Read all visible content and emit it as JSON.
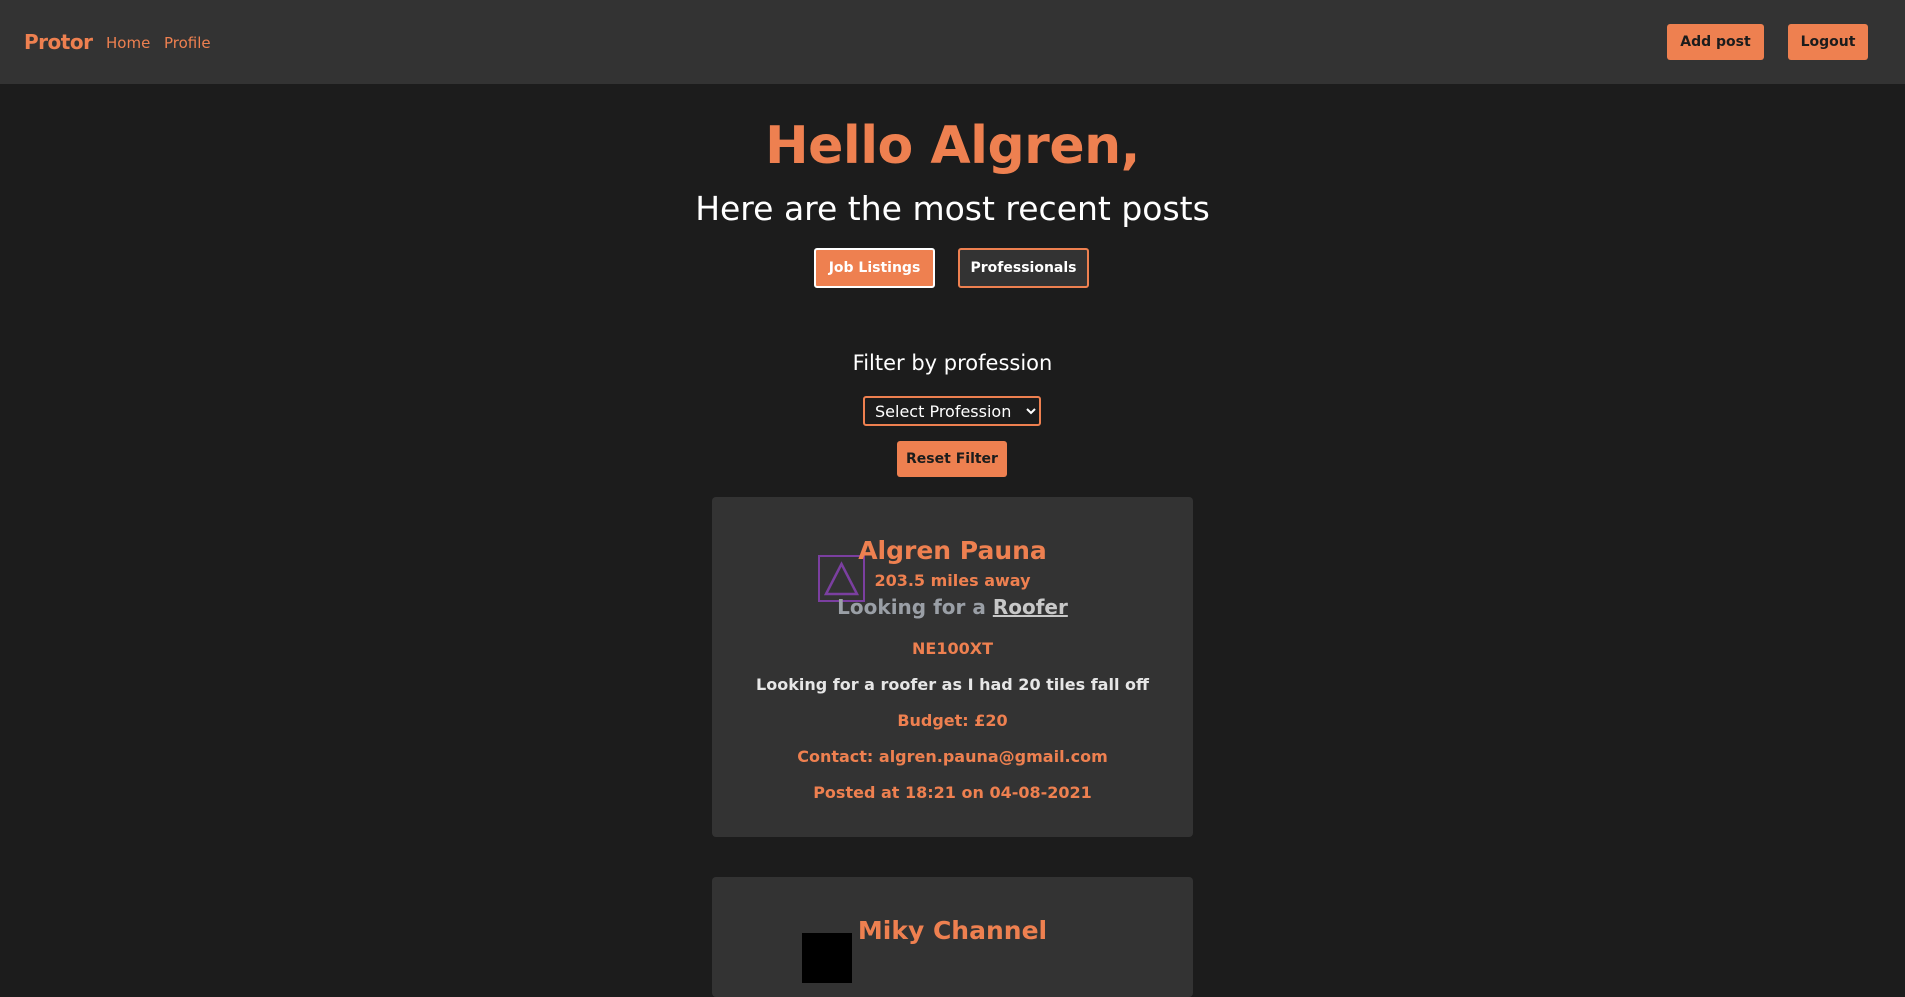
{
  "nav": {
    "brand": "Protor",
    "links": [
      "Home",
      "Profile"
    ],
    "add_post_label": "Add post",
    "logout_label": "Logout"
  },
  "hero": {
    "greeting": "Hello Algren,",
    "subtitle": "Here are the most recent posts"
  },
  "toggle": {
    "job_listings_label": "Job Listings",
    "professionals_label": "Professionals",
    "active": "Job Listings"
  },
  "filter": {
    "label": "Filter by profession",
    "select_value": "Select Profession",
    "reset_label": "Reset Filter"
  },
  "posts": [
    {
      "name": "Algren Pauna",
      "distance": "203.5 miles away",
      "looking_prefix": "Looking for a",
      "profession": "Roofer",
      "postcode": "NE100XT",
      "description": "Looking for a roofer as I had 20 tiles fall off",
      "budget": "Budget: £20",
      "contact": "Contact: algren.pauna@gmail.com",
      "posted": "Posted at 18:21 on 04-08-2021",
      "avatar_icon": "triangle-logo-icon"
    },
    {
      "name": "Miky Channel",
      "avatar_icon": "avatar-icon"
    }
  ],
  "colors": {
    "accent": "#ee8050",
    "background": "#1c1c1c",
    "surface": "#333333",
    "avatar_border": "#7b3fa0"
  }
}
